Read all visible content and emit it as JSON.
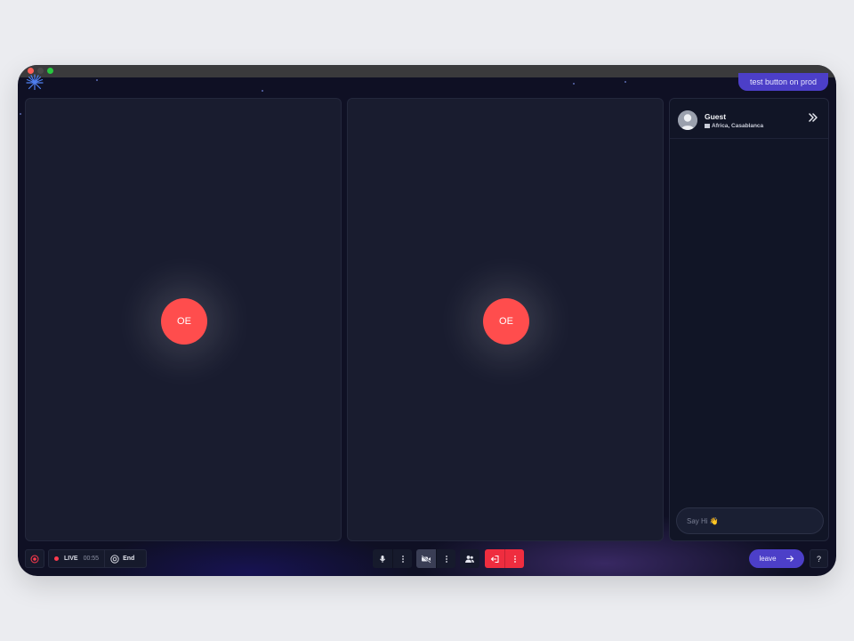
{
  "window": {
    "controls": [
      "close",
      "minimize",
      "maximize"
    ]
  },
  "header": {
    "logo_icon": "starburst-logo",
    "test_button_label": "test button on prod"
  },
  "participants": [
    {
      "initials": "OE",
      "avatar_color": "#ff4d4d"
    },
    {
      "initials": "OE",
      "avatar_color": "#ff4d4d"
    }
  ],
  "side_panel": {
    "guest": {
      "name": "Guest",
      "location": "Africa, Casablanca",
      "flag_icon": "flag-icon"
    },
    "collapse_icon": "double-chevron-right-icon",
    "chat_placeholder": "Say Hi 👋"
  },
  "controls": {
    "live_label": "LIVE",
    "timer": "00:55",
    "end_label": "End",
    "leave_label": "leave",
    "help_label": "?"
  },
  "colors": {
    "accent": "#4c3fc8",
    "danger": "#ef2d3f",
    "live_dot": "#ff3b4e"
  }
}
